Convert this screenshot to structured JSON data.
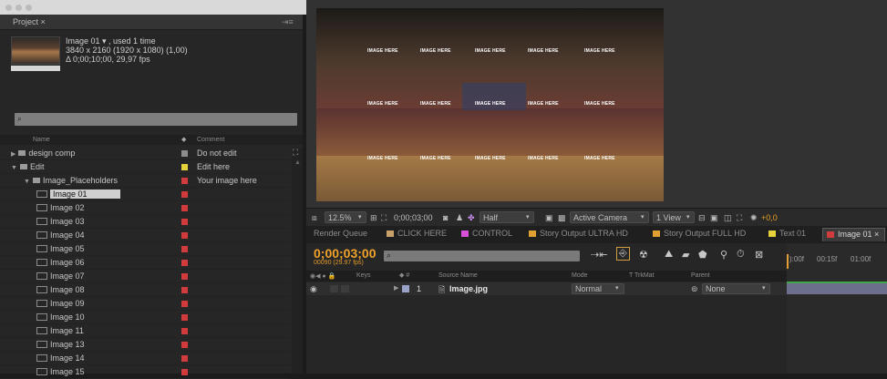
{
  "window": {
    "title_dots": [
      "close",
      "minimize",
      "maximize"
    ]
  },
  "project": {
    "tab_label": "Project",
    "tab_close": "×",
    "menu_glyph": "⇥≡",
    "selected_name": "Image 01 ▾ , used 1 time",
    "dims": "3840 x 2160  (1920 x 1080) (1,00)",
    "duration": "Δ 0;00;10;00, 29,97 fps",
    "search_placeholder": "",
    "search_icon": "⌕",
    "col_name": "Name",
    "col_comment": "Comment",
    "rows": [
      {
        "name": "design comp",
        "type": "folder",
        "depth": 0,
        "open": false,
        "tag": "#8d8d8d",
        "comment": "Do not edit"
      },
      {
        "name": "Edit",
        "type": "folder",
        "depth": 0,
        "open": true,
        "tag": "#e6d23b",
        "comment": "Edit here"
      },
      {
        "name": "Image_Placeholders",
        "type": "folder",
        "depth": 1,
        "open": true,
        "tag": "#d23b3b",
        "comment": "Your image here"
      },
      {
        "name": "Image 01",
        "type": "image",
        "depth": 2,
        "selected": true,
        "tag": "#d23b3b",
        "comment": ""
      },
      {
        "name": "Image 02",
        "type": "image",
        "depth": 2,
        "tag": "#d23b3b",
        "comment": ""
      },
      {
        "name": "Image 03",
        "type": "image",
        "depth": 2,
        "tag": "#d23b3b",
        "comment": ""
      },
      {
        "name": "Image 04",
        "type": "image",
        "depth": 2,
        "tag": "#d23b3b",
        "comment": ""
      },
      {
        "name": "Image 05",
        "type": "image",
        "depth": 2,
        "tag": "#d23b3b",
        "comment": ""
      },
      {
        "name": "Image 06",
        "type": "image",
        "depth": 2,
        "tag": "#d23b3b",
        "comment": ""
      },
      {
        "name": "Image 07",
        "type": "image",
        "depth": 2,
        "tag": "#d23b3b",
        "comment": ""
      },
      {
        "name": "Image 08",
        "type": "image",
        "depth": 2,
        "tag": "#d23b3b",
        "comment": ""
      },
      {
        "name": "Image 09",
        "type": "image",
        "depth": 2,
        "tag": "#d23b3b",
        "comment": ""
      },
      {
        "name": "Image 10",
        "type": "image",
        "depth": 2,
        "tag": "#d23b3b",
        "comment": ""
      },
      {
        "name": "Image 11",
        "type": "image",
        "depth": 2,
        "tag": "#d23b3b",
        "comment": ""
      },
      {
        "name": "Image 13",
        "type": "image",
        "depth": 2,
        "tag": "#d23b3b",
        "comment": ""
      },
      {
        "name": "Image 14",
        "type": "image",
        "depth": 2,
        "tag": "#d23b3b",
        "comment": ""
      },
      {
        "name": "Image 15",
        "type": "image",
        "depth": 2,
        "tag": "#d23b3b",
        "comment": ""
      }
    ]
  },
  "composition": {
    "placeholder_text": "IMAGE HERE",
    "zoom": "12.5%",
    "timecode": "0;00;03;00",
    "resolution": "Half",
    "camera": "Active Camera",
    "view": "1 View",
    "exposure": "+0,0"
  },
  "timeline": {
    "tabs": [
      {
        "label": "Render Queue",
        "color": ""
      },
      {
        "label": "CLICK HERE",
        "color": "#c9a06a"
      },
      {
        "label": "CONTROL",
        "color": "#d84fd8"
      },
      {
        "label": "Story Output ULTRA HD",
        "color": "#e0a030"
      },
      {
        "label": "Story Output FULL HD",
        "color": "#e0a030"
      },
      {
        "label": "Text 01",
        "color": "#e6d23b"
      },
      {
        "label": "Image 01",
        "color": "#d23b3b",
        "active": true
      }
    ],
    "current_time": "0;00;03;00",
    "fps_label": "00090 (29.97 fps)",
    "search_placeholder": "",
    "columns": {
      "keys": "Keys",
      "source": "Source Name",
      "mode": "Mode",
      "trk": "T  TrkMat",
      "parent": "Parent"
    },
    "layer": {
      "index": "1",
      "name": "Image.jpg",
      "mode": "Normal",
      "parent": "None"
    },
    "ruler": [
      "):00f",
      "00:15f",
      "01:00f"
    ]
  }
}
